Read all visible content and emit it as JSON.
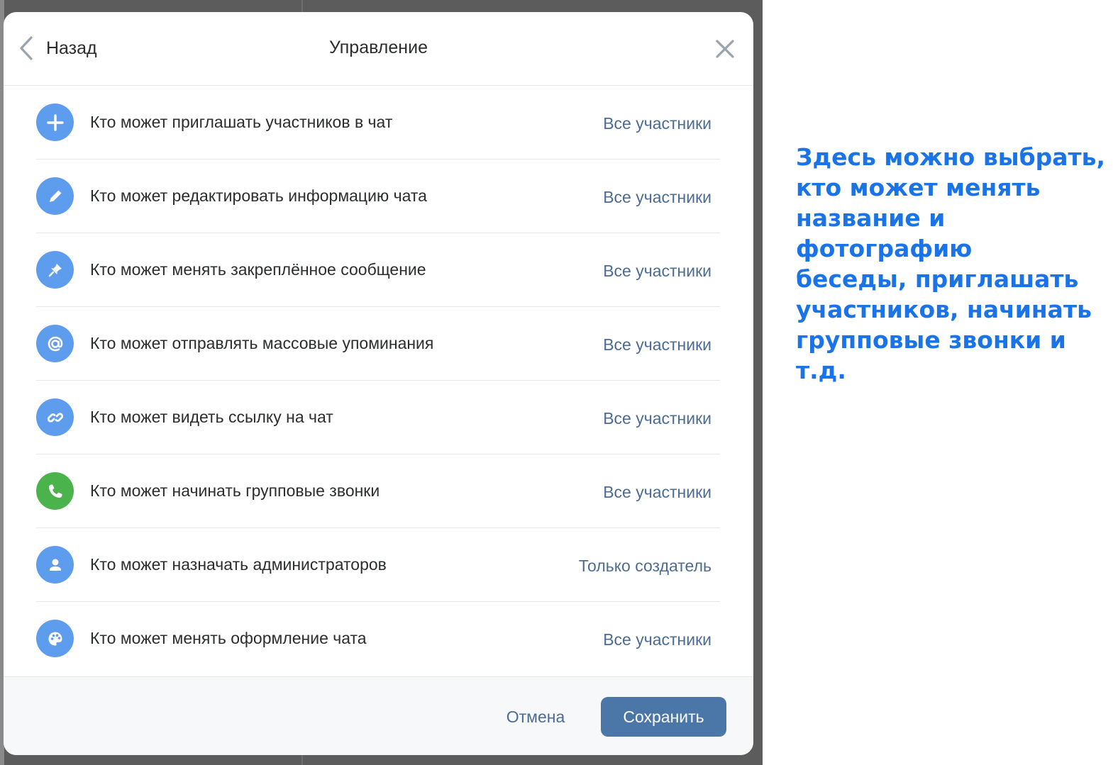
{
  "header": {
    "back_label": "Назад",
    "title": "Управление"
  },
  "settings": [
    {
      "label": "Кто может приглашать участников в чат",
      "value": "Все участники",
      "icon": "plus-icon"
    },
    {
      "label": "Кто может редактировать информацию чата",
      "value": "Все участники",
      "icon": "pencil-icon"
    },
    {
      "label": "Кто может менять закреплённое сообщение",
      "value": "Все участники",
      "icon": "pin-icon"
    },
    {
      "label": "Кто может отправлять массовые упоминания",
      "value": "Все участники",
      "icon": "at-sign-icon"
    },
    {
      "label": "Кто может видеть ссылку на чат",
      "value": "Все участники",
      "icon": "link-icon"
    },
    {
      "label": "Кто может начинать групповые звонки",
      "value": "Все участники",
      "icon": "phone-icon"
    },
    {
      "label": "Кто может назначать администраторов",
      "value": "Только создатель",
      "icon": "user-icon"
    },
    {
      "label": "Кто может менять оформление чата",
      "value": "Все участники",
      "icon": "palette-icon"
    }
  ],
  "footer": {
    "cancel_label": "Отмена",
    "save_label": "Сохранить"
  },
  "annotation": {
    "lines": [
      "Здесь можно выбрать,",
      "кто может менять",
      "название и фотографию",
      "беседы, приглашать",
      "участников, начинать",
      "групповые звонки и т.д."
    ]
  },
  "colors": {
    "icon_blue": "#5e9ded",
    "icon_green": "#4bb34b",
    "link_blue": "#4c6c93",
    "primary_button": "#4a76a8",
    "annotation_text": "#1a74e8"
  }
}
